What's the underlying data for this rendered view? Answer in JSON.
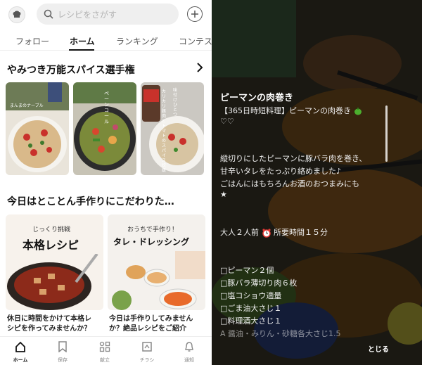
{
  "search": {
    "placeholder": "レシピをさがす"
  },
  "tabs": [
    {
      "label": "フォロー"
    },
    {
      "label": "ホーム"
    },
    {
      "label": "ランキング"
    },
    {
      "label": "コンテス"
    }
  ],
  "section1": {
    "title": "やみつき万能スパイス選手権"
  },
  "thumbs": [
    {
      "overlay": "まんまのナーブル"
    },
    {
      "overlay": "ペーンコール"
    },
    {
      "overlay": "味付けひとつ"
    },
    {
      "overlay": "カリカリ豚肉とトマトのスパイス炊飯"
    }
  ],
  "section2": {
    "title": "今日はとことん手作りにこだわりた…"
  },
  "cards": [
    {
      "sub": "じっくり挑戦",
      "heading": "本格レシピ",
      "caption1": "休日に時間をかけて本格レ",
      "caption2": "シピを作ってみませんか？"
    },
    {
      "sub": "おうちで手作り！",
      "heading": "タレ・ドレッシング",
      "caption1": "今日は手作りしてみません",
      "caption2": "か？絶品レシピをご紹介"
    }
  ],
  "nav": [
    {
      "label": "ホーム"
    },
    {
      "label": "保存"
    },
    {
      "label": "献立"
    },
    {
      "label": "チラシ"
    },
    {
      "label": "通知"
    }
  ],
  "recipe": {
    "title": "ピーマンの肉巻き",
    "line1": "【365日時短料理】ピーマンの肉巻き",
    "line2": "♡♡",
    "desc1": "縦切りにしたピーマンに豚バラ肉を巻き、",
    "desc2": "甘辛いタレをたっぷり絡めました♪",
    "desc3": "ごはんにはもちろんお酒のおつまみにも",
    "star": "★",
    "servings": "大人２人前",
    "time": "所要時間１５分",
    "ingredients": [
      "□ピーマン２個",
      "□豚バラ薄切り肉６枚",
      "□塩コショウ適量",
      "□ごま油大さじ１",
      "□料理酒大さじ１",
      "A 醤油・みりん・砂糖各大さじ1.5"
    ],
    "close": "とじる"
  }
}
